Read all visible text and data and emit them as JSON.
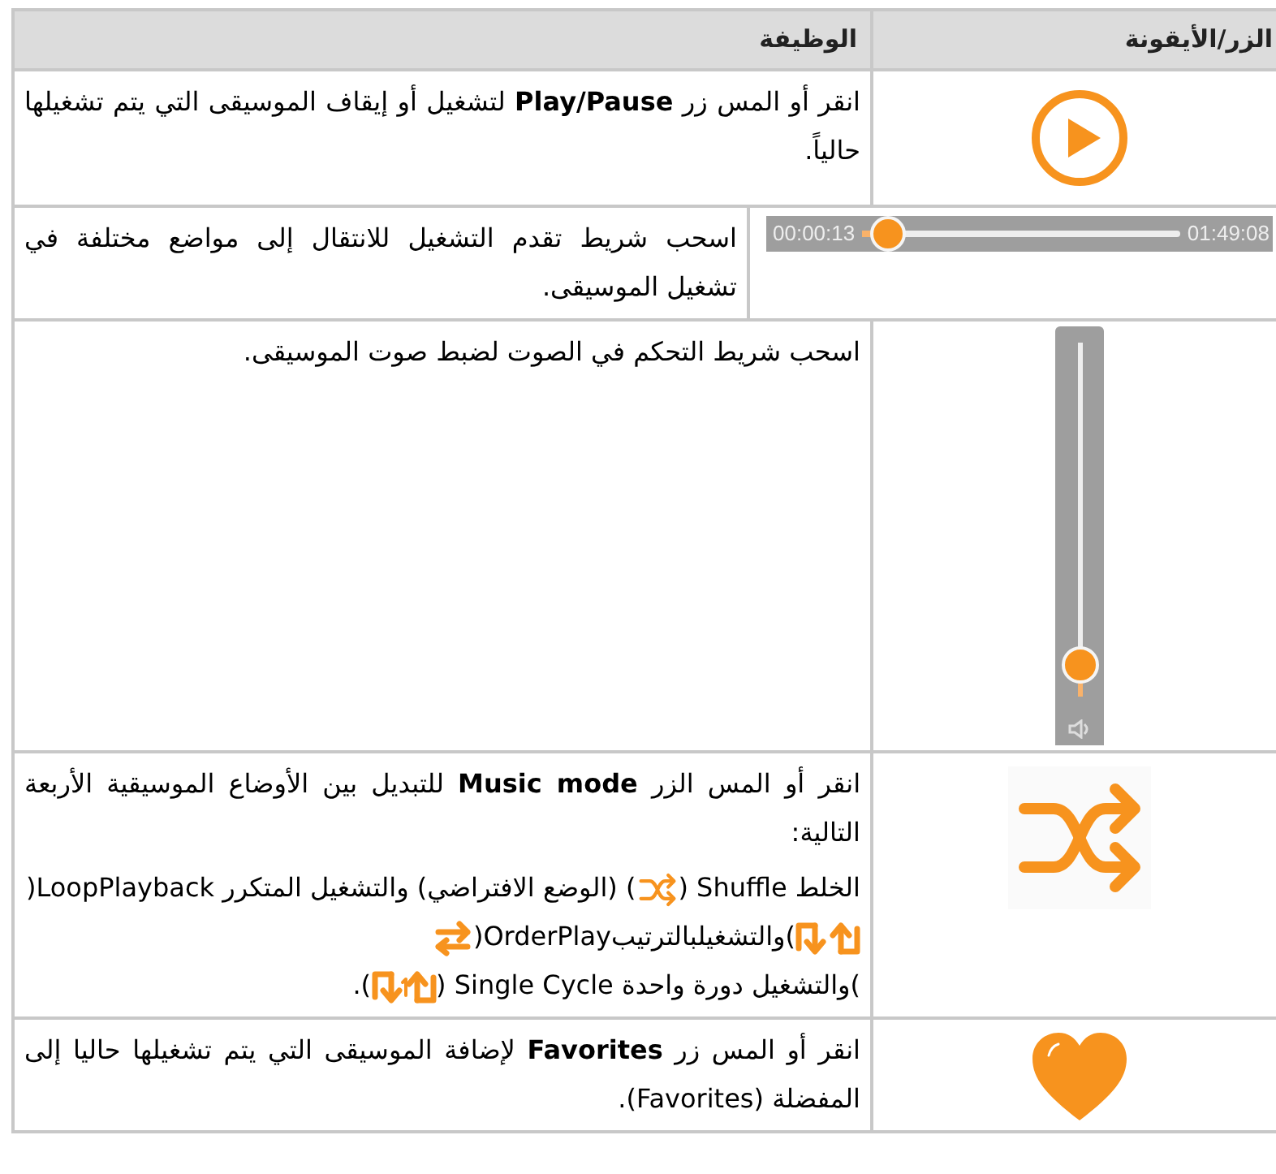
{
  "table": {
    "columns": [
      "الزر/الأيقونة",
      "الوظيفة"
    ],
    "rows": [
      {
        "kind": "play",
        "paragraphs": [
          [
            {
              "text": "انقر أو المس زر **Play/Pause** لتشغيل أو إيقاف الموسيقى التي يتم تشغيلها حالياً."
            }
          ]
        ]
      },
      {
        "kind": "progress",
        "elapsed": "00:00:13",
        "total": "01:49:08",
        "level": 0.03,
        "paragraphs": [
          [
            {
              "text": "اسحب شريط تقدم التشغيل للانتقال إلى مواضع مختلفة في تشغيل الموسيقى."
            }
          ]
        ]
      },
      {
        "kind": "volume",
        "level": 0.04,
        "paragraphs": [
          [
            {
              "text": "اسحب شريط التحكم في الصوت لضبط صوت الموسيقى."
            }
          ]
        ]
      },
      {
        "kind": "shuffle",
        "paragraphs": [
          [
            {
              "text": "انقر أو المس الزر **Music mode** للتبديل بين الأوضاع الموسيقية الأربعة التالية:"
            }
          ],
          [
            {
              "text": "الخلط Shuffle ("
            },
            {
              "text": ") (الوضع الافتراضي) والتشغيل المتكرر LoopPlayback("
            },
            {
              "text": ")والتشغيلبالترتيبOrderPlay("
            },
            {
              "text": ")والتشغيل دورة واحدة Single Cycle ("
            },
            {
              "text": ")."
            }
          ]
        ]
      },
      {
        "kind": "heart",
        "paragraphs": [
          [
            {
              "text": "انقر أو المس زر **Favorites** لإضافة الموسيقى التي يتم تشغيلها حاليا إلى المفضلة (Favorites)."
            }
          ]
        ]
      }
    ]
  }
}
